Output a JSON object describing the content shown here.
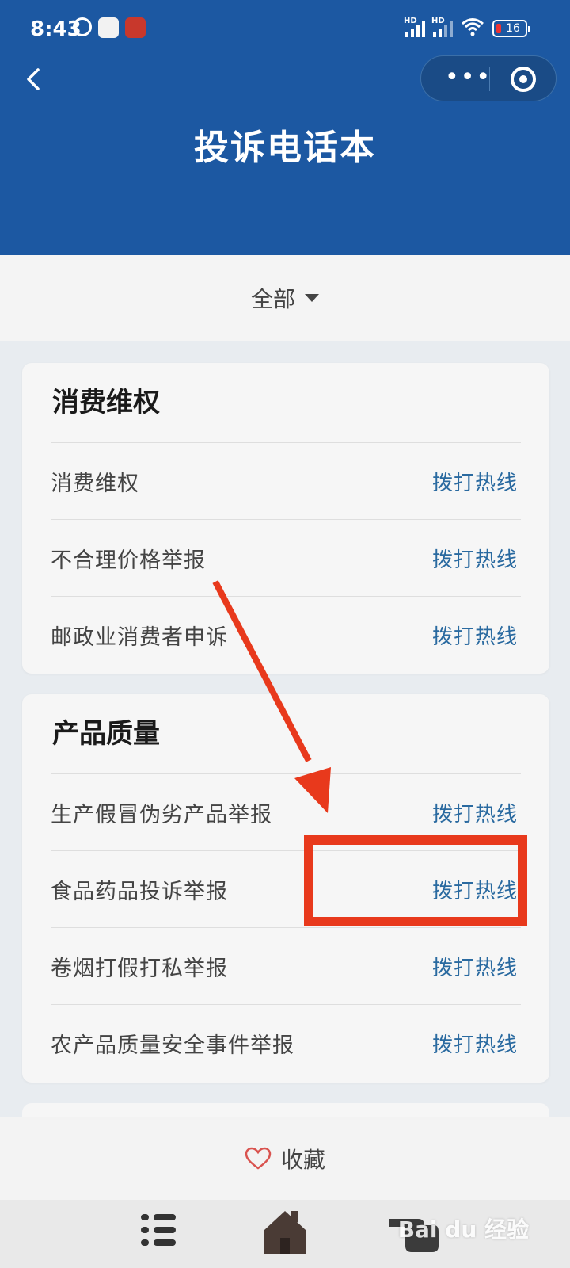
{
  "status_bar": {
    "time": "8:43",
    "battery": "16",
    "network_badges": [
      "HD",
      "HD"
    ],
    "icons": [
      "alarm-icon",
      "app-icon",
      "app-icon",
      "signal-icon",
      "signal-icon",
      "wifi-icon",
      "battery-icon"
    ]
  },
  "header": {
    "title": "投诉电话本",
    "back_icon": "chevron-left-icon",
    "capsule": {
      "more_label": "•••",
      "close_icon": "target-icon"
    }
  },
  "filter": {
    "label": "全部"
  },
  "sections": [
    {
      "title": "消费维权",
      "items": [
        {
          "label": "消费维权",
          "action": "拨打热线"
        },
        {
          "label": "不合理价格举报",
          "action": "拨打热线"
        },
        {
          "label": "邮政业消费者申诉",
          "action": "拨打热线"
        }
      ]
    },
    {
      "title": "产品质量",
      "items": [
        {
          "label": "生产假冒伪劣产品举报",
          "action": "拨打热线"
        },
        {
          "label": "食品药品投诉举报",
          "action": "拨打热线"
        },
        {
          "label": "卷烟打假打私举报",
          "action": "拨打热线"
        },
        {
          "label": "农产品质量安全事件举报",
          "action": "拨打热线"
        }
      ]
    }
  ],
  "favorite": {
    "label": "收藏",
    "icon": "heart-icon"
  },
  "tab_bar": {
    "icons": [
      "list-icon",
      "home-icon",
      "pointing-hand-icon"
    ]
  },
  "watermark": "Bai du 经验",
  "colors": {
    "header": "#1c58a2",
    "action": "#2a6aa0",
    "annotation": "#e8391c"
  }
}
